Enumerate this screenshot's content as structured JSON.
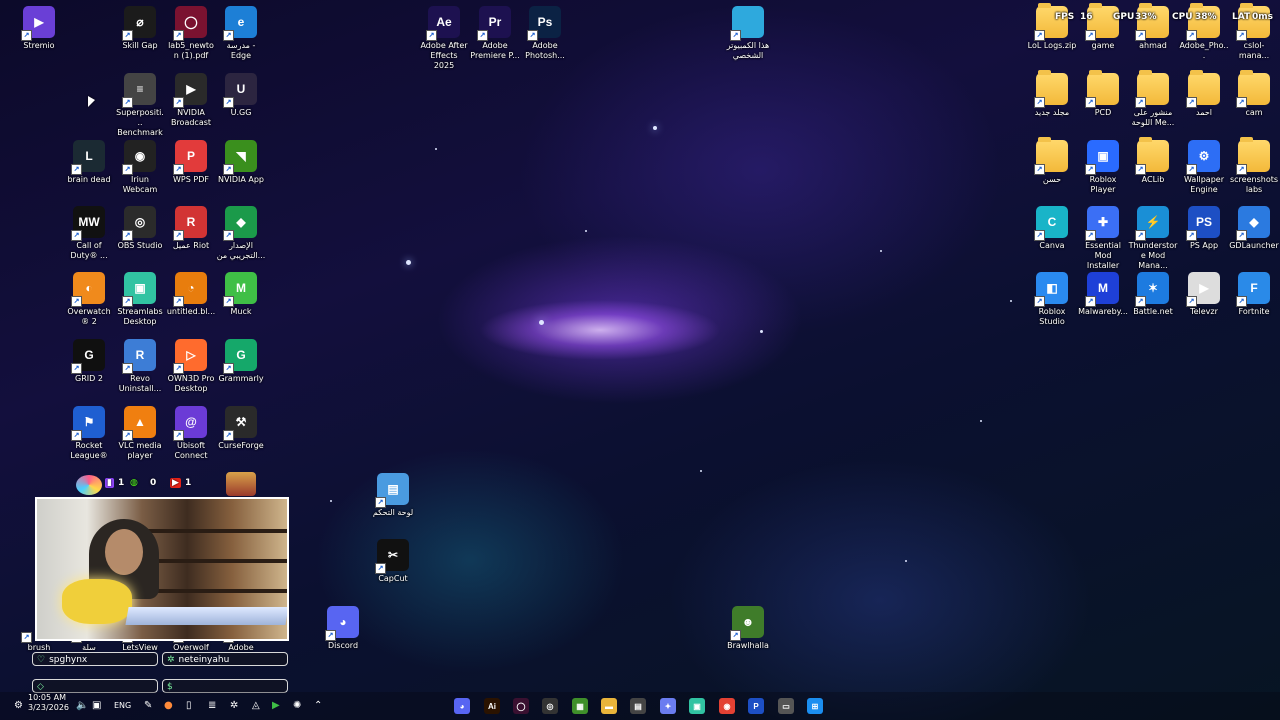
{
  "desktop_icons": {
    "left": [
      {
        "label": "Stremio",
        "icon": "stremio-icon",
        "color": "#6a3fd6",
        "glyph": "▶"
      },
      {
        "label": "Skill Gap",
        "icon": "skill-gap-icon",
        "color": "#1b1b1b",
        "glyph": "⌀"
      },
      {
        "label": "lab5_newton (1).pdf",
        "icon": "pdf-icon",
        "color": "#7a1230",
        "glyph": "◯"
      },
      {
        "label": "مدرسة - Edge",
        "icon": "edge-icon",
        "color": "#1d7fd6",
        "glyph": "e"
      },
      {
        "label": "Superpositi... Benchmark",
        "icon": "superposition-icon",
        "color": "#444",
        "glyph": "≡"
      },
      {
        "label": "NVIDIA Broadcast",
        "icon": "nvidia-broadcast-icon",
        "color": "#2a2a2a",
        "glyph": "▶"
      },
      {
        "label": "U.GG",
        "icon": "ugg-icon",
        "color": "#2c2540",
        "glyph": "U"
      },
      {
        "label": "brain dead",
        "icon": "league-icon",
        "color": "#1b2a33",
        "glyph": "L"
      },
      {
        "label": "Iriun Webcam",
        "icon": "iriun-icon",
        "color": "#222",
        "glyph": "◉"
      },
      {
        "label": "WPS PDF",
        "icon": "wps-pdf-icon",
        "color": "#e23b3b",
        "glyph": "P"
      },
      {
        "label": "NVIDIA App",
        "icon": "nvidia-app-icon",
        "color": "#3a8f1d",
        "glyph": "◥"
      },
      {
        "label": "Call of Duty® ...",
        "icon": "cod-icon",
        "color": "#111",
        "glyph": "MW"
      },
      {
        "label": "OBS Studio",
        "icon": "obs-icon",
        "color": "#2b2b2b",
        "glyph": "◎"
      },
      {
        "label": "عميل Riot",
        "icon": "riot-icon",
        "color": "#d23434",
        "glyph": "R"
      },
      {
        "label": "الإصدار التجريبي من...",
        "icon": "xbox-beta-icon",
        "color": "#1b9a4a",
        "glyph": "◆"
      },
      {
        "label": "Overwatch® 2",
        "icon": "overwatch-icon",
        "color": "#f08a1c",
        "glyph": "◐"
      },
      {
        "label": "Streamlabs Desktop",
        "icon": "streamlabs-icon",
        "color": "#31c3a2",
        "glyph": "▣"
      },
      {
        "label": "untitled.bl...",
        "icon": "blender-icon",
        "color": "#e87d0d",
        "glyph": "◔"
      },
      {
        "label": "Muck",
        "icon": "muck-icon",
        "color": "#3fbf46",
        "glyph": "M"
      },
      {
        "label": "GRID 2",
        "icon": "grid2-icon",
        "color": "#101010",
        "glyph": "G"
      },
      {
        "label": "Revo Uninstall...",
        "icon": "revo-icon",
        "color": "#3d7dd6",
        "glyph": "R"
      },
      {
        "label": "OWN3D Pro Desktop",
        "icon": "own3d-icon",
        "color": "#ff6b2d",
        "glyph": "▷"
      },
      {
        "label": "Grammarly",
        "icon": "grammarly-icon",
        "color": "#15a86a",
        "glyph": "G"
      },
      {
        "label": "Rocket League®",
        "icon": "rocket-league-icon",
        "color": "#1f5fd1",
        "glyph": "⚑"
      },
      {
        "label": "VLC media player",
        "icon": "vlc-icon",
        "color": "#f07f10",
        "glyph": "▲"
      },
      {
        "label": "Ubisoft Connect",
        "icon": "ubisoft-icon",
        "color": "#6b3bd6",
        "glyph": "@"
      },
      {
        "label": "CurseForge",
        "icon": "curseforge-icon",
        "color": "#2a2a2a",
        "glyph": "⚒"
      },
      {
        "label": "Discord",
        "icon": "discord-icon",
        "color": "#5865f2",
        "glyph": "◕"
      },
      {
        "label": "brush",
        "icon": "folder-icon",
        "color": "",
        "glyph": ""
      },
      {
        "label": "سلة",
        "icon": "recycle-icon",
        "color": "#777",
        "glyph": ""
      },
      {
        "label": "LetsView",
        "icon": "letsview-icon",
        "color": "#555",
        "glyph": ""
      },
      {
        "label": "Overwolf",
        "icon": "overwolf-icon",
        "color": "#555",
        "glyph": ""
      },
      {
        "label": "Adobe",
        "icon": "adobe-icon",
        "color": "#555",
        "glyph": ""
      }
    ],
    "top": [
      {
        "label": "Adobe After Effects 2025",
        "icon": "after-effects-icon",
        "color": "#1d1150",
        "glyph": "Ae"
      },
      {
        "label": "Adobe Premiere P...",
        "icon": "premiere-icon",
        "color": "#1d1150",
        "glyph": "Pr"
      },
      {
        "label": "Adobe Photosh...",
        "icon": "photoshop-icon",
        "color": "#0b2244",
        "glyph": "Ps"
      },
      {
        "label": "هذا الكمبيوتر الشخصي",
        "icon": "this-pc-icon",
        "color": "#2ea9dd",
        "glyph": ""
      },
      {
        "label": "لوحة التحكم",
        "icon": "control-panel-icon",
        "color": "#4a9be0",
        "glyph": "▤"
      },
      {
        "label": "CapCut",
        "icon": "capcut-icon",
        "color": "#111",
        "glyph": "✂"
      },
      {
        "label": "Brawlhalla",
        "icon": "brawlhalla-icon",
        "color": "#3f7c2a",
        "glyph": "☻"
      }
    ],
    "right": [
      {
        "label": "LoL Logs.zip",
        "icon": "zip-folder-icon",
        "folder": true
      },
      {
        "label": "game",
        "icon": "folder-icon",
        "folder": true
      },
      {
        "label": "ahmad",
        "icon": "folder-icon",
        "folder": true
      },
      {
        "label": "Adobe_Pho...",
        "icon": "folder-icon",
        "folder": true
      },
      {
        "label": "cslol-mana...",
        "icon": "folder-icon",
        "folder": true
      },
      {
        "label": "مجلد جديد",
        "icon": "folder-icon",
        "folder": true
      },
      {
        "label": "PCD",
        "icon": "folder-icon",
        "folder": true
      },
      {
        "label": "منشور على اللوحة Me...",
        "icon": "folder-icon",
        "folder": true
      },
      {
        "label": "احمد",
        "icon": "folder-icon",
        "folder": true
      },
      {
        "label": "cam",
        "icon": "folder-icon",
        "folder": true
      },
      {
        "label": "حسن",
        "icon": "folder-icon",
        "folder": true
      },
      {
        "label": "Roblox Player",
        "icon": "roblox-icon",
        "color": "#2a6bff",
        "glyph": "▣"
      },
      {
        "label": "ACLib",
        "icon": "folder-icon",
        "folder": true
      },
      {
        "label": "Wallpaper Engine",
        "icon": "wallpaper-engine-icon",
        "color": "#2d6ef5",
        "glyph": "⚙"
      },
      {
        "label": "screenshots labs",
        "icon": "folder-icon",
        "folder": true
      },
      {
        "label": "Canva",
        "icon": "canva-icon",
        "color": "#19b4c8",
        "glyph": "C"
      },
      {
        "label": "Essential Mod Installer",
        "icon": "essential-icon",
        "color": "#3b6ff5",
        "glyph": "✚"
      },
      {
        "label": "Thunderstore Mod Mana...",
        "icon": "thunderstore-icon",
        "color": "#1a8fd6",
        "glyph": "⚡"
      },
      {
        "label": "PS App",
        "icon": "ps-app-icon",
        "color": "#1d4fc4",
        "glyph": "PS"
      },
      {
        "label": "GDLauncher",
        "icon": "gdlauncher-icon",
        "color": "#2b7ae0",
        "glyph": "◆"
      },
      {
        "label": "Roblox Studio",
        "icon": "roblox-studio-icon",
        "color": "#2a8af0",
        "glyph": "◧"
      },
      {
        "label": "Malwareby...",
        "icon": "malwarebytes-icon",
        "color": "#1e40d8",
        "glyph": "M"
      },
      {
        "label": "Battle.net",
        "icon": "battlenet-icon",
        "color": "#1d7be0",
        "glyph": "✶"
      },
      {
        "label": "Televzr",
        "icon": "televzr-icon",
        "color": "#ddd",
        "glyph": "▶"
      },
      {
        "label": "Fortnite",
        "icon": "fortnite-icon",
        "color": "#2a8ae8",
        "glyph": "F"
      }
    ]
  },
  "overlay": {
    "fps_label": "FPS",
    "fps_value": "16",
    "gpu_label": "GPU",
    "gpu_value": "33%",
    "cpu_label": "CPU",
    "cpu_value": "38%",
    "lat_label": "LAT",
    "lat_value": "0ms"
  },
  "stream_badges": [
    {
      "text": "1",
      "icon": "twitch-icon"
    },
    {
      "text": "0",
      "icon": "kick-icon"
    },
    {
      "text": "1",
      "icon": "youtube-icon"
    }
  ],
  "chat_boxes": [
    {
      "icon": "heart-icon",
      "glyph": "♡",
      "text": "spghynx"
    },
    {
      "icon": "gear-icon",
      "glyph": "✲",
      "text": "neteinyahu"
    },
    {
      "icon": "diamond-icon",
      "glyph": "◇",
      "text": ""
    },
    {
      "icon": "dollar-icon",
      "glyph": "$",
      "text": ""
    }
  ],
  "clock": {
    "time": "10:05 AM",
    "date": "3/23/2026"
  },
  "tray": {
    "language": "ENG"
  },
  "taskbar_apps": [
    {
      "icon": "discord-taskbar-icon",
      "color": "#5865f2",
      "glyph": "◕"
    },
    {
      "icon": "illustrator-taskbar-icon",
      "color": "#2a1200",
      "glyph": "Ai"
    },
    {
      "icon": "pdf-taskbar-icon",
      "color": "#3a1030",
      "glyph": "◯"
    },
    {
      "icon": "obs-taskbar-icon",
      "color": "#333",
      "glyph": "◎"
    },
    {
      "icon": "minecraft-taskbar-icon",
      "color": "#3f8f2a",
      "glyph": "▦"
    },
    {
      "icon": "file-explorer-icon",
      "color": "#e9b43a",
      "glyph": "▬"
    },
    {
      "icon": "store-icon",
      "color": "#444",
      "glyph": "▤"
    },
    {
      "icon": "copilot-icon",
      "color": "#6a7cf0",
      "glyph": "✦"
    },
    {
      "icon": "streamlabs-taskbar-icon",
      "color": "#31c3a2",
      "glyph": "▣"
    },
    {
      "icon": "chrome-icon",
      "color": "#e34133",
      "glyph": "◉"
    },
    {
      "icon": "ps-taskbar-icon",
      "color": "#1d4fc4",
      "glyph": "P"
    },
    {
      "icon": "task-view-icon",
      "color": "#555",
      "glyph": "▭"
    },
    {
      "icon": "windows-start-icon",
      "color": "#1b8ef0",
      "glyph": "⊞"
    }
  ]
}
